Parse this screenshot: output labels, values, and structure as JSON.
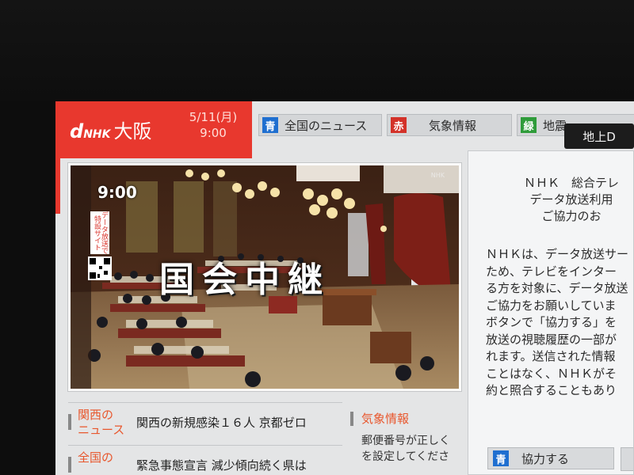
{
  "broadcast": {
    "logo_mark": "d",
    "logo_nhk": "NHK",
    "logo_station": "大阪",
    "date": "5/11(月)",
    "time": "9:00"
  },
  "tabs": [
    {
      "key": "青",
      "label": "全国のニュース",
      "color": "#1f6fd0"
    },
    {
      "key": "赤",
      "label": "気象情報",
      "color": "#d33229"
    },
    {
      "key": "緑",
      "label": "地震",
      "color": "#2f9c3a"
    }
  ],
  "channel_chip": "地上D",
  "video": {
    "clock": "9:00",
    "caption": "国会中継",
    "qr_banner": "データ放送で特設サイト",
    "watermark": "NHK"
  },
  "data_panel": {
    "title_lines": [
      "ＮＨＫ　総合テレ",
      "データ放送利用",
      "ご協力のお"
    ],
    "body_lines": [
      "ＮＨＫは、データ放送サー",
      "ため、テレビをインター",
      "る方を対象に、データ放送",
      "ご協力をお願いしていま",
      "ボタンで「協力する」を",
      "放送の視聴履歴の一部が",
      "れます。送信された情報",
      "ことはなく、ＮＨＫがそ",
      "約と照合することもあり"
    ],
    "agree_key": "青",
    "agree_label": "協力する"
  },
  "news": [
    {
      "category": "関西の\nニュース",
      "headline": "関西の新規感染１６人 京都ゼロ"
    },
    {
      "category": "全国の",
      "headline": "緊急事態宣言 減少傾向続く県は"
    }
  ],
  "weather": {
    "category": "気象情報",
    "lines": [
      "郵便番号が正しく",
      "を設定してくださ"
    ]
  },
  "colors": {
    "brand_red": "#e8382e",
    "category_orange": "#e8572d"
  }
}
